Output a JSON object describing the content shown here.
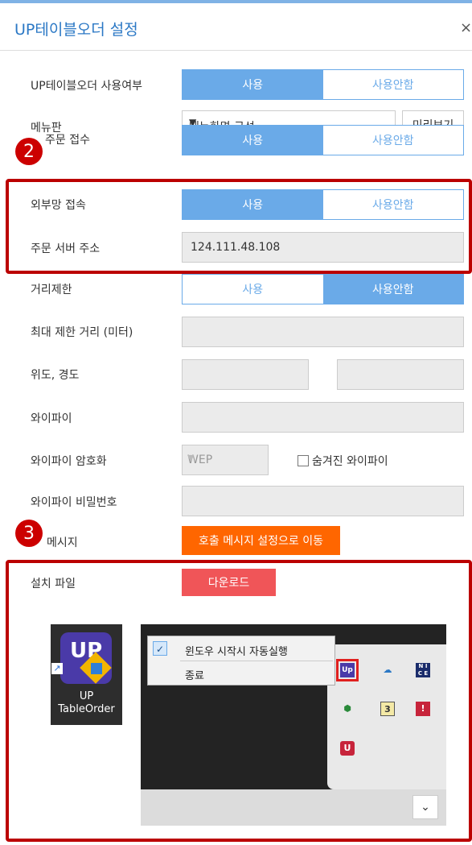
{
  "dialog": {
    "title": "UP테이블오더 설정",
    "close": "×"
  },
  "rows": {
    "use": {
      "label": "UP테이블오더 사용여부",
      "on": "사용",
      "off": "사용안함"
    },
    "menu": {
      "label": "메뉴판",
      "value": "메뉴화면 구성",
      "preview": "미리보기"
    },
    "order": {
      "label": "주문 접수",
      "on": "사용",
      "off": "사용안함"
    },
    "external": {
      "label": "외부망 접속",
      "on": "사용",
      "off": "사용안함"
    },
    "server": {
      "label": "주문 서버 주소",
      "value": "124.111.48.108"
    },
    "distance": {
      "label": "거리제한",
      "on": "사용",
      "off": "사용안함"
    },
    "maxdist": {
      "label": "최대 제한 거리 (미터)"
    },
    "latlng": {
      "label": "위도, 경도"
    },
    "wifi": {
      "label": "와이파이"
    },
    "wifienc": {
      "label": "와이파이 암호화",
      "value": "WEP",
      "hidden": "숨겨진 와이파이"
    },
    "wifipw": {
      "label": "와이파이 비밀번호"
    },
    "callmsg": {
      "label": "메시지",
      "button": "호출 메시지 설정으로 이동"
    },
    "install": {
      "label": "설치 파일",
      "button": "다운로드"
    }
  },
  "badges": {
    "b2": "2",
    "b3": "3"
  },
  "shortcut": {
    "tile_text": "UP",
    "caption1": "UP",
    "caption2": "TableOrder"
  },
  "context_menu": {
    "item1": "윈도우 시작시 자동실행",
    "item2": "종료"
  },
  "tray_icons": {
    "num": "3",
    "nice": "N I C E"
  },
  "colors": {
    "accent": "#6aaae8",
    "title": "#2b78c5",
    "orange": "#ff6600",
    "red": "#f05558",
    "highlight": "#b00000"
  }
}
